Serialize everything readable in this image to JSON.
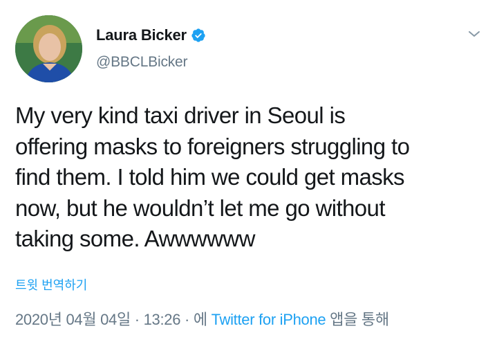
{
  "tweet": {
    "author": {
      "display_name": "Laura Bicker",
      "handle": "@BBCLBicker",
      "verified_icon": "verified-badge-icon",
      "avatar_icon": "profile-avatar"
    },
    "menu_icon": "chevron-down-icon",
    "text": "My very kind taxi driver in Seoul is\noffering masks to foreigners struggling to\nfind them. I told him we could get masks\nnow, but he wouldn’t let me go without\ntaking some. Awwwwww",
    "translate_label": "트윗 번역하기",
    "meta": {
      "date": "2020년 04월 04일",
      "sep1": " · ",
      "time": "13:26",
      "sep2": " · ",
      "via_prefix": "에 ",
      "source": "Twitter for iPhone",
      "via_suffix": " 앱을 통해"
    }
  },
  "colors": {
    "accent": "#1da1f2",
    "secondary_text": "#657786",
    "primary_text": "#14171a",
    "verified": "#1da1f2"
  }
}
